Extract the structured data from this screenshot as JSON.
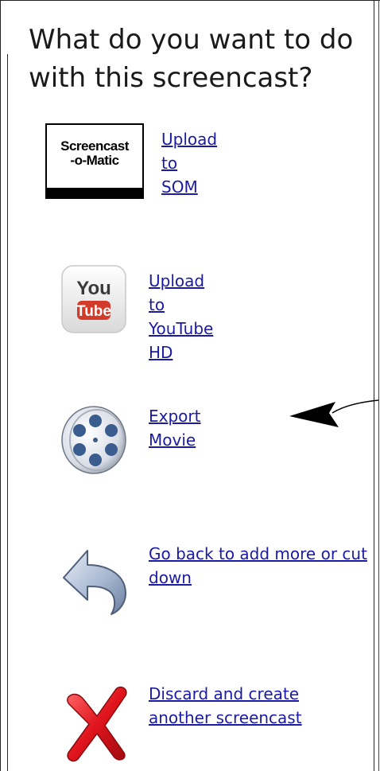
{
  "prompt": {
    "title": "What do you want to do with this screencast?"
  },
  "logos": {
    "screencast_o_matic": "Screencast\n-o-Matic",
    "youtube_you": "You",
    "youtube_tube": "Tube"
  },
  "options": {
    "upload_som": "Upload to SOM",
    "upload_youtube": "Upload to YouTube HD",
    "export_movie": "Export Movie",
    "go_back": "Go back to add more or cut down",
    "discard": "Discard and create another screencast"
  },
  "colors": {
    "link": "#1a1aa6",
    "youtube_red": "#d23a2a",
    "discard_red": "#d8141c"
  },
  "icons": {
    "upload_som": "screencast-o-matic-logo-icon",
    "upload_youtube": "youtube-icon",
    "export_movie": "film-reel-icon",
    "go_back": "back-arrow-icon",
    "discard": "red-x-icon"
  }
}
